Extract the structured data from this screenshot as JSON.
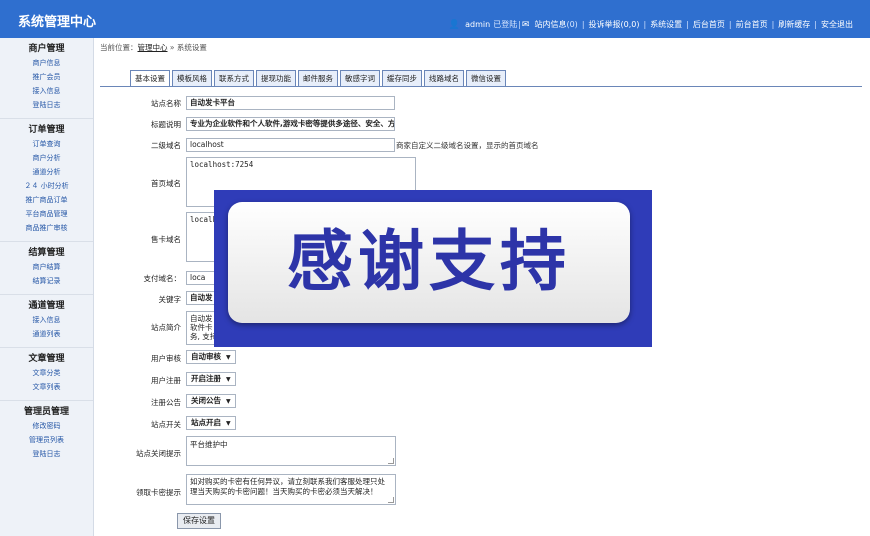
{
  "header": {
    "app_title": "系统管理中心",
    "user": "admin",
    "logged_in": "已登陆",
    "messages_label": "站内信息",
    "messages_count": "(0)",
    "complaints": "投诉举报(0,0)",
    "links": [
      "系统设置",
      "后台首页",
      "前台首页",
      "刷新缓存",
      "安全退出"
    ]
  },
  "sidebar": {
    "groups": [
      {
        "title": "商户管理",
        "items": [
          "商户信息",
          "推广会员",
          "接入信息",
          "登陆日志"
        ]
      },
      {
        "title": "订单管理",
        "items": [
          "订单查询",
          "商户分析",
          "通道分析",
          "２４ 小时分析",
          "推广商品订单",
          "平台商品管理",
          "商品推广审核"
        ]
      },
      {
        "title": "结算管理",
        "items": [
          "商户结算",
          "结算记录"
        ]
      },
      {
        "title": "通道管理",
        "items": [
          "接入信息",
          "通道列表"
        ]
      },
      {
        "title": "文章管理",
        "items": [
          "文章分类",
          "文章列表"
        ]
      },
      {
        "title": "管理员管理",
        "items": [
          "修改密码",
          "管理员列表",
          "登陆日志"
        ]
      }
    ]
  },
  "breadcrumb": {
    "prefix": "当前位置：",
    "link": "管理中心",
    "sep": " » ",
    "current": "系统设置"
  },
  "tabs": [
    "基本设置",
    "模板风格",
    "联系方式",
    "提现功能",
    "邮件服务",
    "敏感字词",
    "缓存同步",
    "线路域名",
    "微信设置"
  ],
  "form": {
    "site_name_label": "站点名称",
    "site_name": "自动发卡平台",
    "title_desc_label": "标题说明",
    "title_desc": "专业为企业软件和个人软件,游戏卡密等提供多途径、安全、方",
    "subdomain_label": "二级域名",
    "subdomain": "localhost",
    "subdomain_hint": "商家自定义二级域名设置，显示的首页域名",
    "home_domain_label": "首页域名",
    "home_domain": "localhost:7254",
    "card_domain_label": "售卡域名",
    "card_domain": "localh",
    "pay_domain_label": "支付域名：",
    "pay_domain": "loca",
    "keywords_label": "关键字",
    "keywords": "自动发",
    "intro_label": "站点简介",
    "intro": "自动发\n软件卡\n务, 支持",
    "user_audit_label": "用户审核",
    "user_audit": "自动审核",
    "user_register_label": "用户注册",
    "user_register": "开启注册",
    "register_notice_label": "注册公告",
    "register_notice": "关闭公告",
    "site_switch_label": "站点开关",
    "site_switch": "站点开启",
    "close_notice_label": "站点关闭提示",
    "close_notice": "平台维护中",
    "card_notice_label": "领取卡密提示",
    "card_notice": "如对购买的卡密有任何异议，请立刻联系我们客服处理只处理当天购买的卡密问题！当天购买的卡密必须当天解决！",
    "save_label": "保存设置"
  },
  "overlay": {
    "text": "感谢支持"
  }
}
